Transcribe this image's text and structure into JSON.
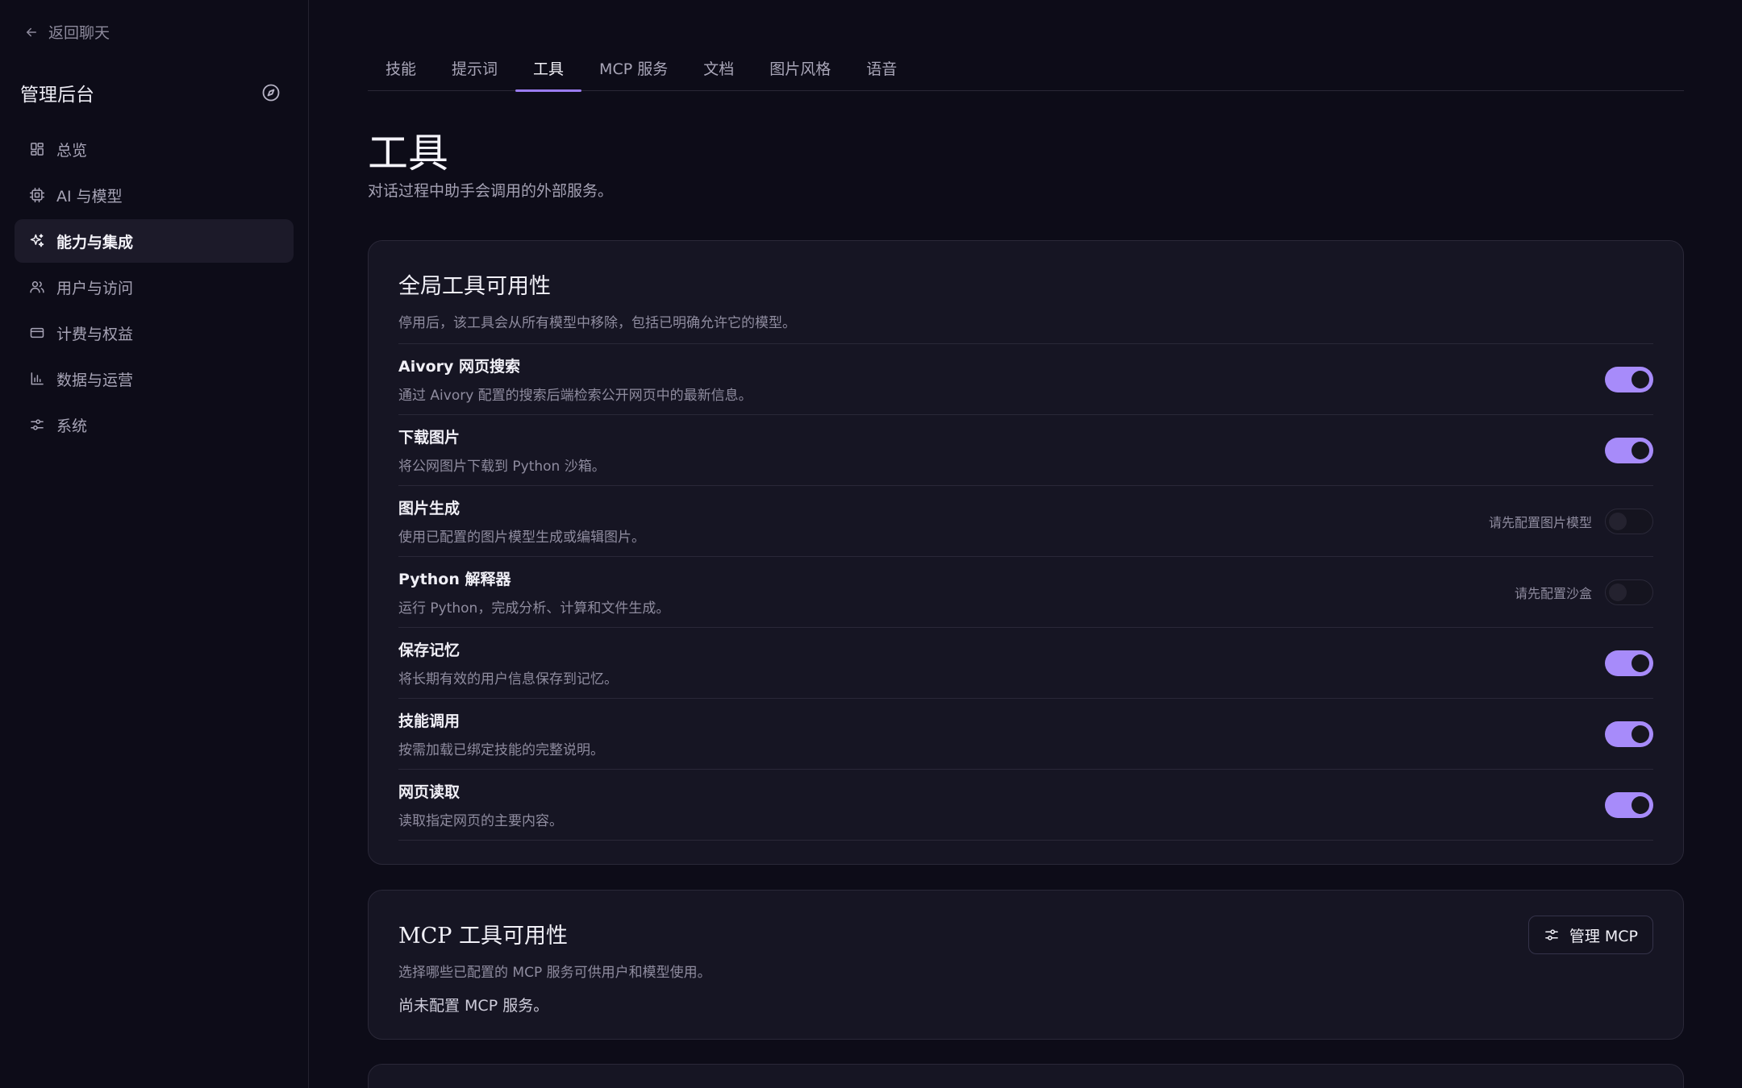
{
  "sidebar": {
    "back_label": "返回聊天",
    "title": "管理后台",
    "items": [
      {
        "label": "总览",
        "icon": "dashboard-icon"
      },
      {
        "label": "AI 与模型",
        "icon": "cpu-icon"
      },
      {
        "label": "能力与集成",
        "icon": "sparkles-icon",
        "active": true
      },
      {
        "label": "用户与访问",
        "icon": "users-icon"
      },
      {
        "label": "计费与权益",
        "icon": "credit-card-icon"
      },
      {
        "label": "数据与运营",
        "icon": "bar-chart-icon"
      },
      {
        "label": "系统",
        "icon": "sliders-icon"
      }
    ]
  },
  "tabs": [
    "技能",
    "提示词",
    "工具",
    "MCP 服务",
    "文档",
    "图片风格",
    "语音"
  ],
  "active_tab": "工具",
  "page": {
    "title": "工具",
    "subtitle": "对话过程中助手会调用的外部服务。"
  },
  "global_tools": {
    "title": "全局工具可用性",
    "description": "停用后，该工具会从所有模型中移除，包括已明确允许它的模型。",
    "tools": [
      {
        "name": "Aivory 网页搜索",
        "desc": "通过 Aivory 配置的搜索后端检索公开网页中的最新信息。",
        "enabled": true,
        "note": ""
      },
      {
        "name": "下载图片",
        "desc": "将公网图片下载到 Python 沙箱。",
        "enabled": true,
        "note": ""
      },
      {
        "name": "图片生成",
        "desc": "使用已配置的图片模型生成或编辑图片。",
        "enabled": false,
        "note": "请先配置图片模型"
      },
      {
        "name": "Python 解释器",
        "desc": "运行 Python，完成分析、计算和文件生成。",
        "enabled": false,
        "note": "请先配置沙盒"
      },
      {
        "name": "保存记忆",
        "desc": "将长期有效的用户信息保存到记忆。",
        "enabled": true,
        "note": ""
      },
      {
        "name": "技能调用",
        "desc": "按需加载已绑定技能的完整说明。",
        "enabled": true,
        "note": ""
      },
      {
        "name": "网页读取",
        "desc": "读取指定网页的主要内容。",
        "enabled": true,
        "note": ""
      }
    ]
  },
  "mcp_tools": {
    "title": "MCP 工具可用性",
    "description": "选择哪些已配置的 MCP 服务可供用户和模型使用。",
    "manage_label": "管理 MCP",
    "empty_text": "尚未配置 MCP 服务。"
  },
  "colors": {
    "accent": "#a78bfa",
    "background": "#0d0c18",
    "card": "#161523"
  }
}
